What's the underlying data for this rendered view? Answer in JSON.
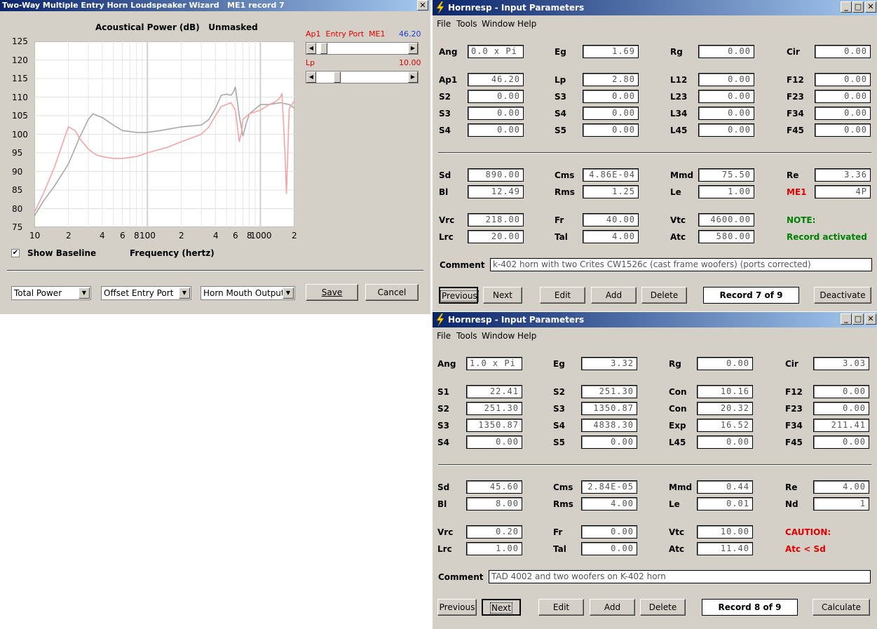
{
  "wizard": {
    "title": "Two-Way Multiple Entry Horn Loudspeaker Wizard   ME1 record 7",
    "close_glyph": "✕",
    "slider1": {
      "label": "Ap1  Entry Port  ME1",
      "value": "46.20",
      "position": 0.05
    },
    "slider2": {
      "label": "Lp",
      "value": "10.00",
      "position": 0.2
    },
    "show_baseline_label": "Show Baseline",
    "show_baseline_checked": true,
    "combo1": "Total Power",
    "combo2": "Offset Entry Port",
    "combo3": "Horn Mouth Output",
    "save_label": "Save",
    "cancel_label": "Cancel"
  },
  "chart_data": {
    "type": "line",
    "title": "Acoustical Power (dB)   Unmasked",
    "xlabel": "Frequency (hertz)",
    "ylabel": "",
    "xscale": "log",
    "xlim": [
      10,
      2000
    ],
    "ylim": [
      75,
      125
    ],
    "grid": true,
    "yticks": [
      "125",
      "120",
      "115",
      "110",
      "105",
      "100",
      "95",
      "90",
      "85",
      "80",
      "75"
    ],
    "xticks": [
      "10",
      "2",
      "4",
      "6",
      "8",
      "100",
      "2",
      "4",
      "6",
      "8",
      "1000",
      "2"
    ],
    "series": [
      {
        "color": "#a8a8a8",
        "x": [
          10,
          12,
          15,
          20,
          25,
          30,
          33,
          40,
          50,
          60,
          80,
          100,
          130,
          200,
          300,
          350,
          400,
          450,
          500,
          550,
          580,
          600,
          650,
          700,
          750,
          800,
          1000,
          1200,
          1500,
          1800,
          2000
        ],
        "y": [
          78,
          82,
          86,
          92,
          99,
          104,
          105.5,
          104.5,
          102.5,
          101,
          100.5,
          100.5,
          101,
          102,
          102.5,
          104,
          107,
          110.5,
          110.8,
          110.5,
          111.5,
          112.8,
          105,
          99.5,
          103,
          105.5,
          108,
          108,
          108.5,
          108,
          107
        ]
      },
      {
        "color": "#f4a4a4",
        "x": [
          10,
          12,
          15,
          18,
          20,
          23,
          25,
          30,
          35,
          40,
          50,
          60,
          80,
          100,
          150,
          200,
          300,
          350,
          400,
          450,
          500,
          550,
          600,
          650,
          680,
          700,
          800,
          1000,
          1200,
          1400,
          1500,
          1550,
          1600,
          1650,
          1700,
          1800,
          2000
        ],
        "y": [
          79,
          84,
          91,
          98,
          102,
          101,
          99,
          96,
          94.5,
          94,
          93.5,
          93.5,
          94,
          95,
          96.5,
          98,
          100,
          102,
          105,
          107.5,
          108,
          108.5,
          106.5,
          98,
          100.5,
          104,
          105.5,
          106.5,
          108,
          109,
          110,
          111,
          103,
          95,
          84,
          107,
          109
        ]
      }
    ]
  },
  "hr1": {
    "title": "Hornresp - Input Parameters",
    "menus": [
      "File",
      "Tools",
      "Window",
      "Help"
    ],
    "params": [
      {
        "label": "Ang",
        "value": "0.0 x Pi",
        "align": "left"
      },
      {
        "label": "Eg",
        "value": "1.69"
      },
      {
        "label": "Rg",
        "value": "0.00"
      },
      {
        "label": "Cir",
        "value": "0.00"
      },
      {
        "label": "Ap1",
        "value": "46.20"
      },
      {
        "label": "Lp",
        "value": "2.80"
      },
      {
        "label": "L12",
        "value": "0.00"
      },
      {
        "label": "F12",
        "value": "0.00"
      },
      {
        "label": "S2",
        "value": "0.00"
      },
      {
        "label": "S3",
        "value": "0.00"
      },
      {
        "label": "L23",
        "value": "0.00"
      },
      {
        "label": "F23",
        "value": "0.00"
      },
      {
        "label": "S3",
        "value": "0.00"
      },
      {
        "label": "S4",
        "value": "0.00"
      },
      {
        "label": "L34",
        "value": "0.00"
      },
      {
        "label": "F34",
        "value": "0.00"
      },
      {
        "label": "S4",
        "value": "0.00"
      },
      {
        "label": "S5",
        "value": "0.00"
      },
      {
        "label": "L45",
        "value": "0.00"
      },
      {
        "label": "F45",
        "value": "0.00"
      },
      {
        "label": "Sd",
        "value": "890.00"
      },
      {
        "label": "Cms",
        "value": "4.86E-04"
      },
      {
        "label": "Mmd",
        "value": "75.50"
      },
      {
        "label": "Re",
        "value": "3.36"
      },
      {
        "label": "Bl",
        "value": "12.49"
      },
      {
        "label": "Rms",
        "value": "1.25"
      },
      {
        "label": "Le",
        "value": "1.00"
      },
      {
        "label": "ME1",
        "value": "4P",
        "labelcolor": "red"
      },
      {
        "label": "Vrc",
        "value": "218.00"
      },
      {
        "label": "Fr",
        "value": "40.00"
      },
      {
        "label": "Vtc",
        "value": "4600.00"
      },
      {
        "label": "Lrc",
        "value": "20.00"
      },
      {
        "label": "Tal",
        "value": "4.00"
      },
      {
        "label": "Atc",
        "value": "580.00"
      }
    ],
    "note_label": "NOTE:",
    "note_text": "Record activated",
    "comment_label": "Comment",
    "comment": "k-402 horn with two Crites CW1526c (cast frame woofers) (ports corrected)",
    "buttons": [
      "Previous",
      "Next",
      "Edit",
      "Add",
      "Delete"
    ],
    "record": "Record 7 of 9",
    "action": "Deactivate"
  },
  "hr2": {
    "title": "Hornresp - Input Parameters",
    "menus": [
      "File",
      "Tools",
      "Window",
      "Help"
    ],
    "params": [
      {
        "label": "Ang",
        "value": "1.0 x Pi",
        "align": "left"
      },
      {
        "label": "Eg",
        "value": "3.32"
      },
      {
        "label": "Rg",
        "value": "0.00"
      },
      {
        "label": "Cir",
        "value": "3.03"
      },
      {
        "label": "S1",
        "value": "22.41"
      },
      {
        "label": "S2",
        "value": "251.30"
      },
      {
        "label": "Con",
        "value": "10.16"
      },
      {
        "label": "F12",
        "value": "0.00"
      },
      {
        "label": "S2",
        "value": "251.30"
      },
      {
        "label": "S3",
        "value": "1350.87"
      },
      {
        "label": "Con",
        "value": "20.32"
      },
      {
        "label": "F23",
        "value": "0.00"
      },
      {
        "label": "S3",
        "value": "1350.87"
      },
      {
        "label": "S4",
        "value": "4838.30"
      },
      {
        "label": "Exp",
        "value": "16.52"
      },
      {
        "label": "F34",
        "value": "211.41"
      },
      {
        "label": "S4",
        "value": "0.00"
      },
      {
        "label": "S5",
        "value": "0.00"
      },
      {
        "label": "L45",
        "value": "0.00"
      },
      {
        "label": "F45",
        "value": "0.00"
      },
      {
        "label": "Sd",
        "value": "45.60"
      },
      {
        "label": "Cms",
        "value": "2.84E-05"
      },
      {
        "label": "Mmd",
        "value": "0.44"
      },
      {
        "label": "Re",
        "value": "4.00"
      },
      {
        "label": "Bl",
        "value": "8.00"
      },
      {
        "label": "Rms",
        "value": "4.00"
      },
      {
        "label": "Le",
        "value": "0.01"
      },
      {
        "label": "Nd",
        "value": "1"
      },
      {
        "label": "Vrc",
        "value": "0.20"
      },
      {
        "label": "Fr",
        "value": "0.00"
      },
      {
        "label": "Vtc",
        "value": "10.00"
      },
      {
        "label": "Lrc",
        "value": "1.00"
      },
      {
        "label": "Tal",
        "value": "0.00"
      },
      {
        "label": "Atc",
        "value": "11.40"
      }
    ],
    "note_label": "CAUTION:",
    "note_text": "Atc < Sd",
    "comment_label": "Comment",
    "comment": "TAD 4002 and two woofers on K-402 horn",
    "buttons": [
      "Previous",
      "Next",
      "Edit",
      "Add",
      "Delete"
    ],
    "record": "Record 8 of 9",
    "action": "Calculate"
  },
  "window_glyphs": {
    "minimize": "_",
    "maximize": "□",
    "close": "✕"
  }
}
